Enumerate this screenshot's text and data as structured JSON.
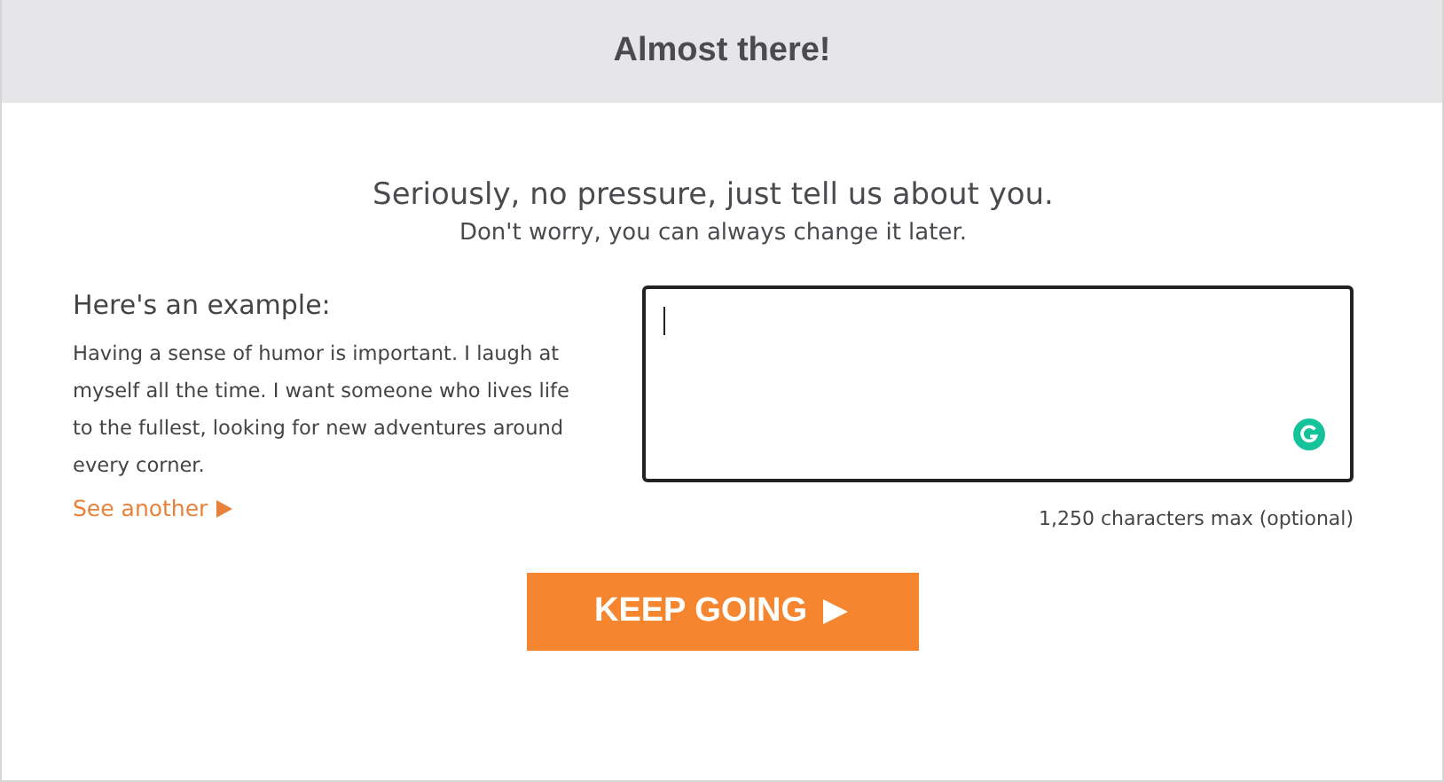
{
  "header": {
    "title": "Almost there!"
  },
  "intro": {
    "headline": "Seriously, no pressure, just tell us about you.",
    "subline": "Don't worry, you can always change it later."
  },
  "example": {
    "heading": "Here's an example:",
    "text": "Having a sense of humor is important. I laugh at myself all the time. I want someone who lives life to the fullest, looking for new adventures around every corner.",
    "link": "See another"
  },
  "field": {
    "hint": "1,250 characters max (optional)"
  },
  "button": {
    "label": "KEEP GOING"
  }
}
